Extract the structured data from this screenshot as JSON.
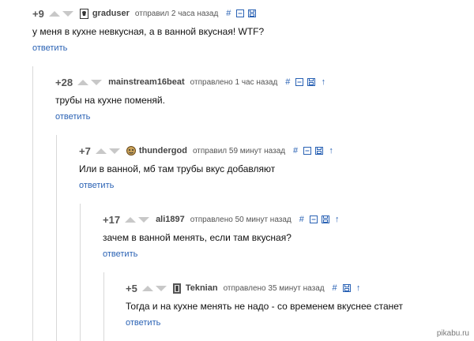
{
  "comments": [
    {
      "rating": "+9",
      "author": "graduser",
      "time": "отправил 2 часа назад",
      "text": "у меня в кухне невкусная, а в ванной вкусная! WTF?",
      "reply": "ответить",
      "hash": "#"
    },
    {
      "rating": "+28",
      "author": "mainstream16beat",
      "time": "отправлено 1 час назад",
      "text": "трубы на кухне поменяй.",
      "reply": "ответить",
      "hash": "#",
      "arrow": "↑"
    },
    {
      "rating": "+7",
      "author": "thundergod",
      "time": "отправил 59 минут назад",
      "text": "Или в ванной, мб там трубы вкус добавляют",
      "reply": "ответить",
      "hash": "#",
      "arrow": "↑"
    },
    {
      "rating": "+17",
      "author": "ali1897",
      "time": "отправлено 50 минут назад",
      "text": "зачем в ванной менять, если там вкусная?",
      "reply": "ответить",
      "hash": "#",
      "arrow": "↑"
    },
    {
      "rating": "+5",
      "author": "Teknian",
      "time": "отправлено 35 минут назад",
      "text": "Тогда и на кухне менять не надо - со временем вкуснее станет",
      "reply": "ответить",
      "hash": "#",
      "arrow": "↑"
    }
  ],
  "watermark": "pikabu.ru",
  "colors": {
    "link": "#2a62b4",
    "rating": "#555555",
    "vote_arrow": "#c8c8c8",
    "thread_line": "#d8d8d8"
  },
  "icons": [
    "hash-link-icon",
    "collapse-icon",
    "save-icon",
    "parent-arrow-icon"
  ]
}
